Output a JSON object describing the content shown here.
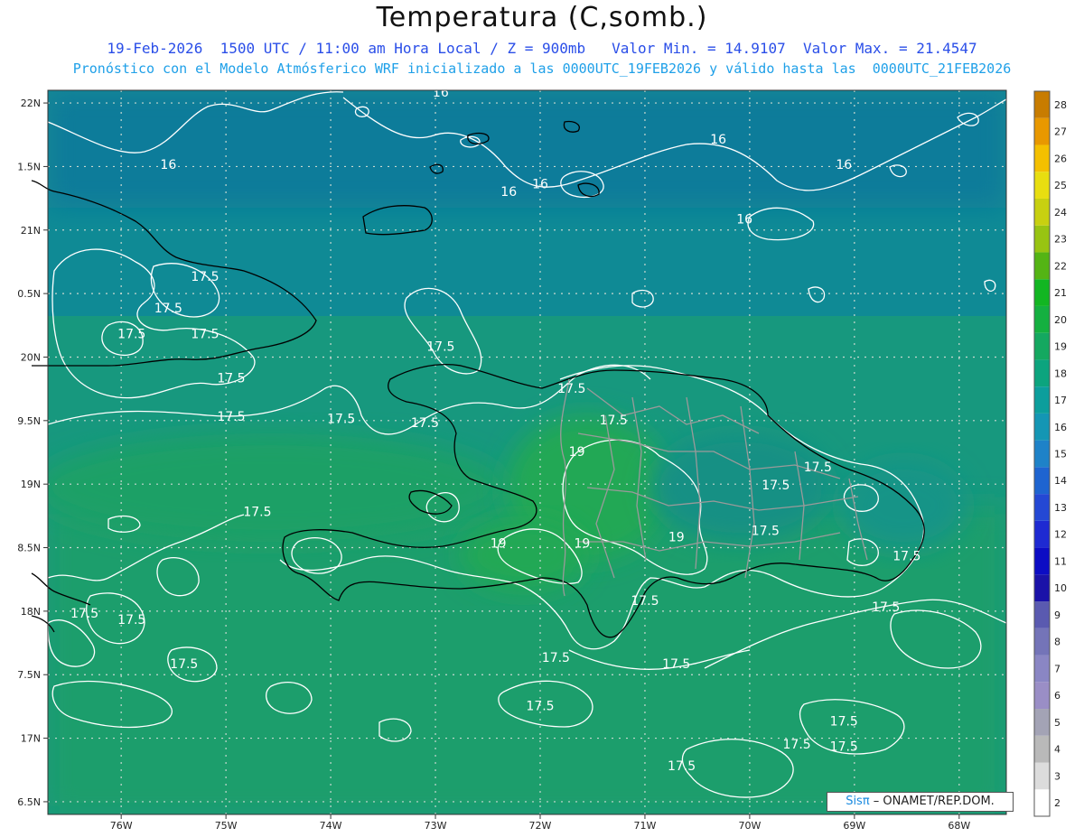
{
  "title": "Temperatura (C,somb.)",
  "subtitle_line1": "19-Feb-2026  1500 UTC / 11:00 am Hora Local / Z = 900mb   Valor Min. = 14.9107  Valor Max. = 21.4547",
  "subtitle_line2": "Pronóstico con el Modelo Atmósferico WRF inicializado a las 0000UTC_19FEB2026 y válido hasta las  0000UTC_21FEB2026",
  "credit": {
    "logo": "Sisπ",
    "text": " – ONAMET/REP.DOM."
  },
  "map": {
    "lon_range": [
      -76.7,
      -67.55
    ],
    "lat_range": [
      16.4,
      22.1
    ],
    "lon_ticks": [
      {
        "value": -76,
        "label": "76W"
      },
      {
        "value": -75,
        "label": "75W"
      },
      {
        "value": -74,
        "label": "74W"
      },
      {
        "value": -73,
        "label": "73W"
      },
      {
        "value": -72,
        "label": "72W"
      },
      {
        "value": -71,
        "label": "71W"
      },
      {
        "value": -70,
        "label": "70W"
      },
      {
        "value": -69,
        "label": "69W"
      },
      {
        "value": -68,
        "label": "68W"
      }
    ],
    "lat_ticks": [
      {
        "value": 22,
        "label": "22N"
      },
      {
        "value": 21.5,
        "label": "1.5N"
      },
      {
        "value": 21,
        "label": "21N"
      },
      {
        "value": 20.5,
        "label": "0.5N"
      },
      {
        "value": 20,
        "label": "20N"
      },
      {
        "value": 19.5,
        "label": "9.5N"
      },
      {
        "value": 19,
        "label": "19N"
      },
      {
        "value": 18.5,
        "label": "8.5N"
      },
      {
        "value": 18,
        "label": "18N"
      },
      {
        "value": 17.5,
        "label": "7.5N"
      },
      {
        "value": 17,
        "label": "17N"
      },
      {
        "value": 16.5,
        "label": "6.5N"
      }
    ],
    "gridlines": "dotted",
    "contour_labels": [
      {
        "text": "16",
        "lon": -75.55,
        "lat": 21.48
      },
      {
        "text": "16",
        "lon": -72.95,
        "lat": 22.05
      },
      {
        "text": "16",
        "lon": -72.3,
        "lat": 21.27
      },
      {
        "text": "16",
        "lon": -72.0,
        "lat": 21.33
      },
      {
        "text": "16",
        "lon": -70.3,
        "lat": 21.68
      },
      {
        "text": "16",
        "lon": -70.05,
        "lat": 21.05
      },
      {
        "text": "16",
        "lon": -69.1,
        "lat": 21.48
      },
      {
        "text": "17.5",
        "lon": -75.2,
        "lat": 20.6
      },
      {
        "text": "17.5",
        "lon": -75.55,
        "lat": 20.35
      },
      {
        "text": "17.5",
        "lon": -75.9,
        "lat": 20.15
      },
      {
        "text": "17.5",
        "lon": -75.2,
        "lat": 20.15
      },
      {
        "text": "17.5",
        "lon": -74.95,
        "lat": 19.8
      },
      {
        "text": "17.5",
        "lon": -74.95,
        "lat": 19.5
      },
      {
        "text": "17.5",
        "lon": -73.9,
        "lat": 19.48
      },
      {
        "text": "17.5",
        "lon": -73.1,
        "lat": 19.45
      },
      {
        "text": "17.5",
        "lon": -72.95,
        "lat": 20.05
      },
      {
        "text": "17.5",
        "lon": -71.7,
        "lat": 19.72
      },
      {
        "text": "17.5",
        "lon": -71.3,
        "lat": 19.47
      },
      {
        "text": "17.5",
        "lon": -69.35,
        "lat": 19.1
      },
      {
        "text": "17.5",
        "lon": -69.75,
        "lat": 18.96
      },
      {
        "text": "17.5",
        "lon": -69.85,
        "lat": 18.6
      },
      {
        "text": "17.5",
        "lon": -68.5,
        "lat": 18.4
      },
      {
        "text": "17.5",
        "lon": -68.7,
        "lat": 18.0
      },
      {
        "text": "17.5",
        "lon": -71.0,
        "lat": 18.05
      },
      {
        "text": "17.5",
        "lon": -74.7,
        "lat": 18.75
      },
      {
        "text": "17.5",
        "lon": -76.35,
        "lat": 17.95
      },
      {
        "text": "17.5",
        "lon": -75.9,
        "lat": 17.9
      },
      {
        "text": "17.5",
        "lon": -75.4,
        "lat": 17.55
      },
      {
        "text": "17.5",
        "lon": -71.85,
        "lat": 17.6
      },
      {
        "text": "17.5",
        "lon": -70.7,
        "lat": 17.55
      },
      {
        "text": "17.5",
        "lon": -72.0,
        "lat": 17.22
      },
      {
        "text": "17.5",
        "lon": -69.55,
        "lat": 16.92
      },
      {
        "text": "17.5",
        "lon": -69.1,
        "lat": 17.1
      },
      {
        "text": "17.5",
        "lon": -69.1,
        "lat": 16.9
      },
      {
        "text": "17.5",
        "lon": -70.65,
        "lat": 16.75
      },
      {
        "text": "19",
        "lon": -71.65,
        "lat": 19.22
      },
      {
        "text": "19",
        "lon": -71.6,
        "lat": 18.5
      },
      {
        "text": "19",
        "lon": -72.4,
        "lat": 18.5
      },
      {
        "text": "19",
        "lon": -70.7,
        "lat": 18.55
      }
    ]
  },
  "colorbar": {
    "levels": [
      "2",
      "3",
      "4",
      "5",
      "6",
      "7",
      "8",
      "9",
      "10",
      "11",
      "12",
      "13",
      "14",
      "15",
      "16",
      "17",
      "18",
      "19",
      "20",
      "21",
      "22",
      "23",
      "24",
      "25",
      "26",
      "27",
      "28"
    ],
    "colors": [
      "#ffffff",
      "#dcdcdc",
      "#b9b9b9",
      "#a3a3b5",
      "#9a8ec6",
      "#8a86c4",
      "#7474b8",
      "#5a5ab0",
      "#1a12a8",
      "#0c0cc4",
      "#1e2ad2",
      "#2448d4",
      "#1e64d0",
      "#1e82c8",
      "#1496b4",
      "#0c9e9c",
      "#0ca47e",
      "#14a860",
      "#14b040",
      "#12b622",
      "#54b414",
      "#98c412",
      "#c8d010",
      "#e8de10",
      "#f4c000",
      "#e89800",
      "#c87c00"
    ]
  }
}
